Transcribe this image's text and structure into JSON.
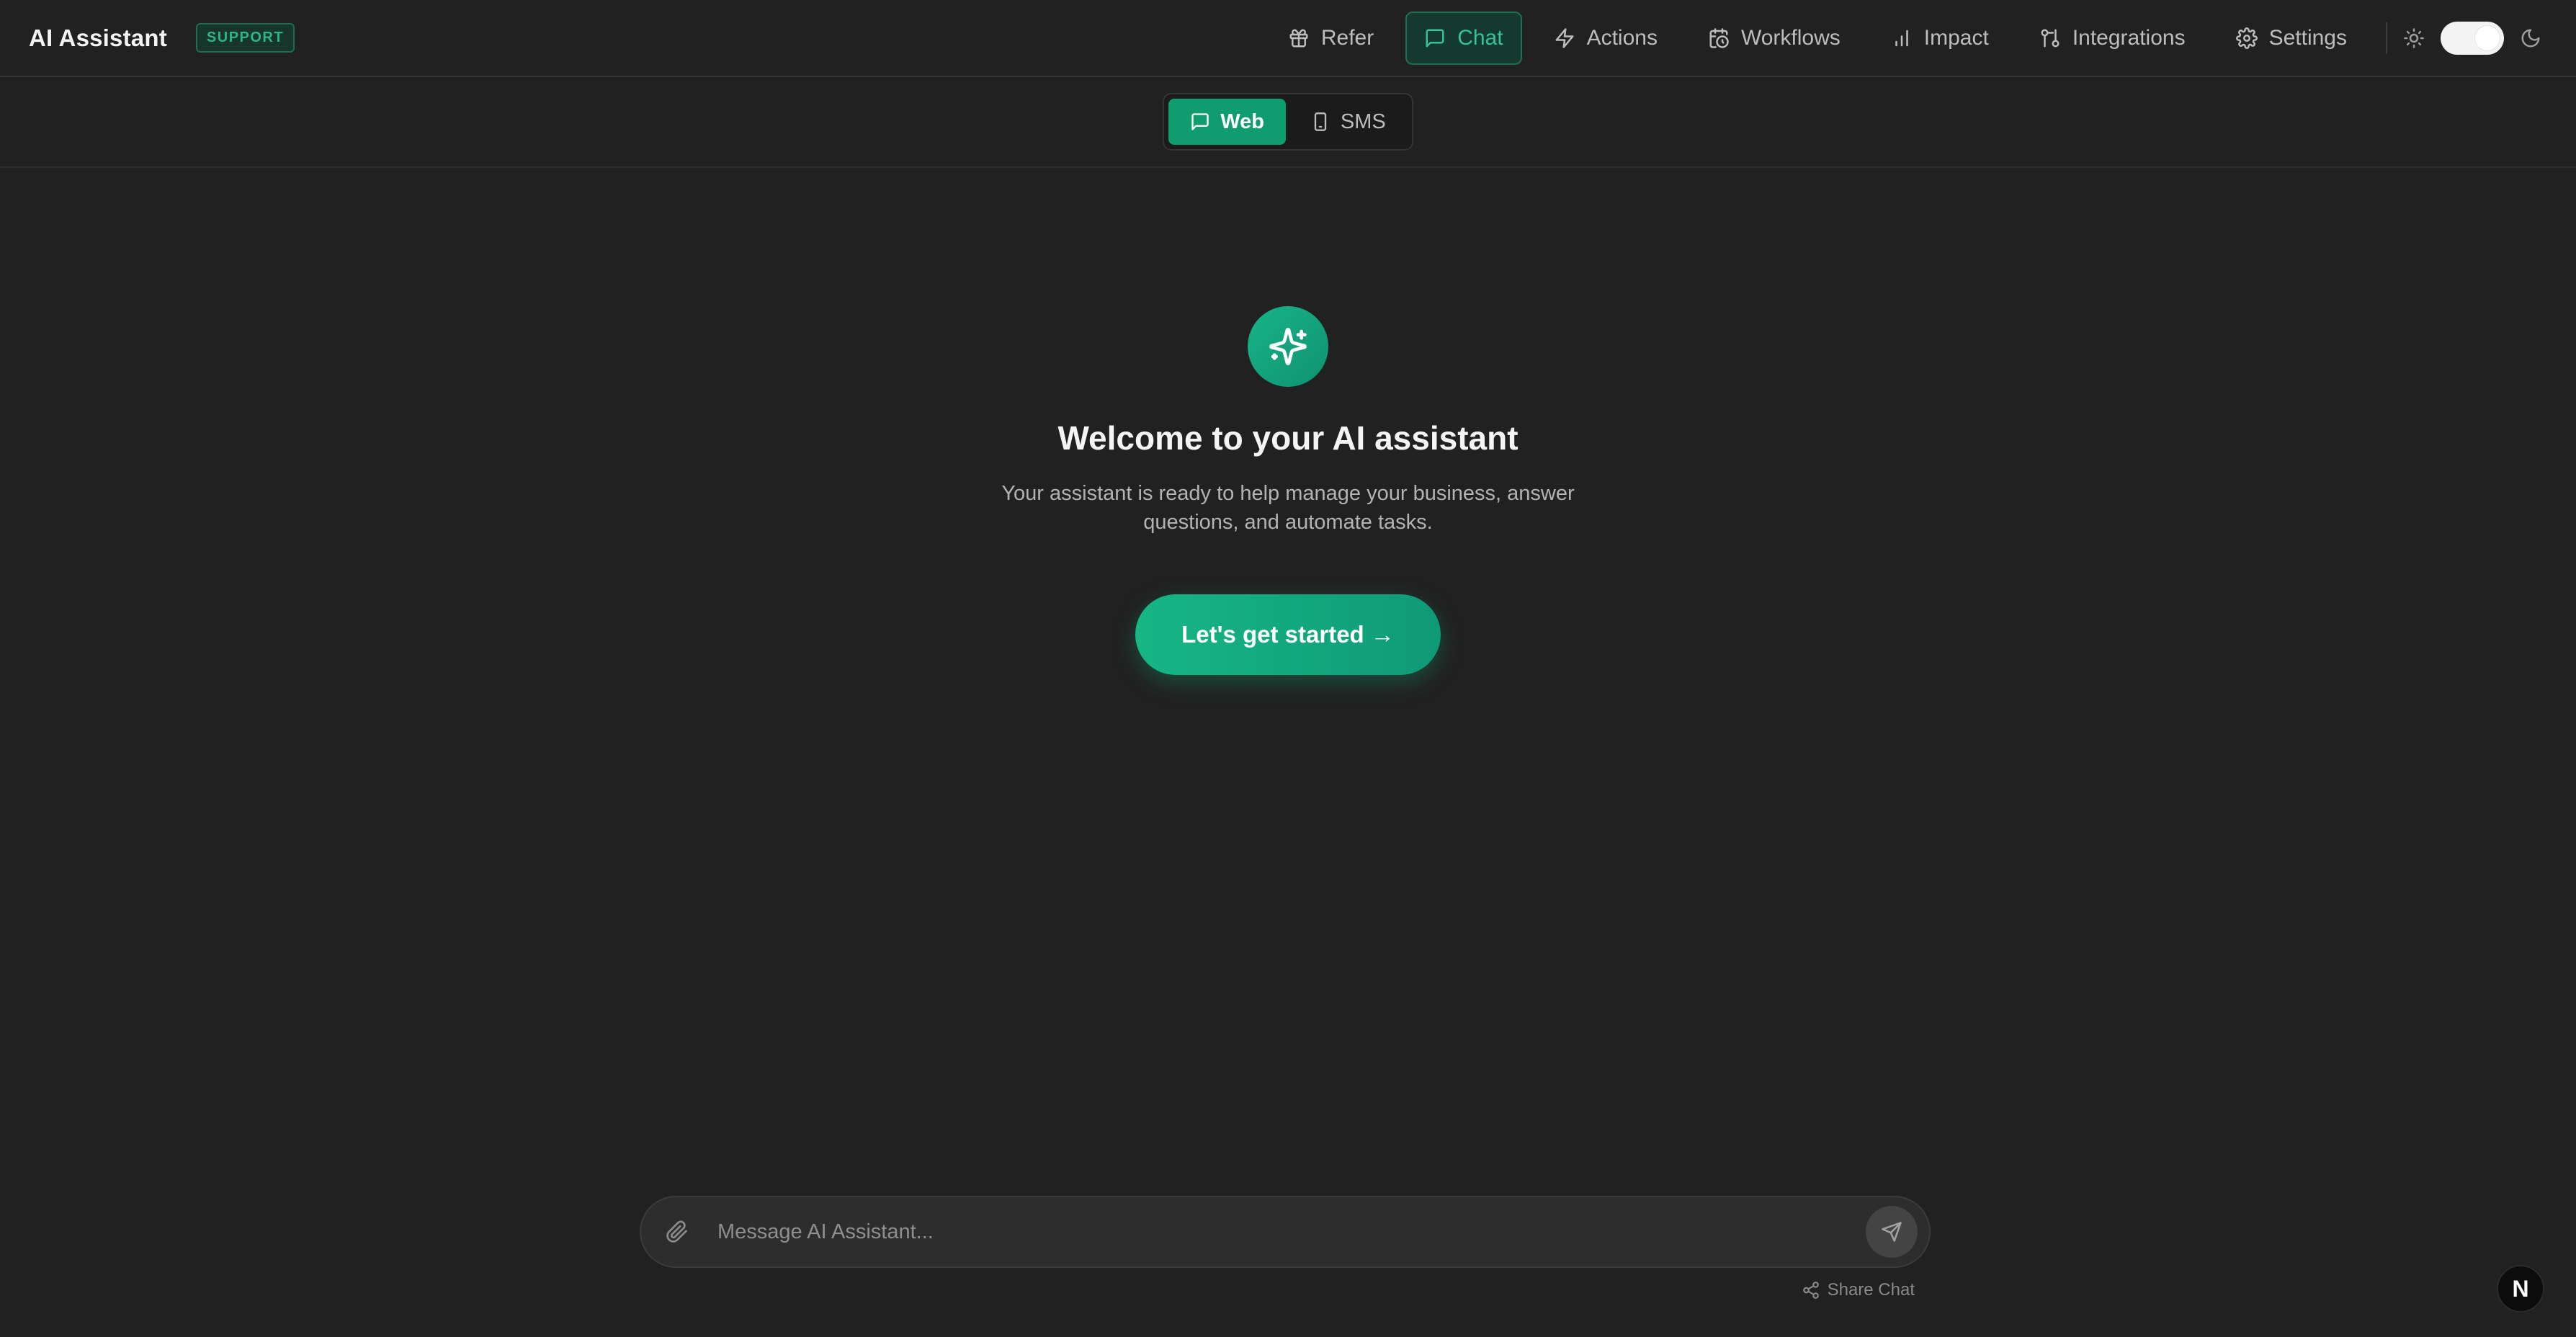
{
  "header": {
    "title": "AI Assistant",
    "badge": "SUPPORT",
    "nav": [
      {
        "label": "Refer",
        "icon": "gift-icon"
      },
      {
        "label": "Chat",
        "icon": "chat-icon",
        "active": true
      },
      {
        "label": "Actions",
        "icon": "lightning-icon"
      },
      {
        "label": "Workflows",
        "icon": "calendar-clock-icon"
      },
      {
        "label": "Impact",
        "icon": "bar-chart-icon"
      },
      {
        "label": "Integrations",
        "icon": "integrations-icon"
      },
      {
        "label": "Settings",
        "icon": "gear-icon"
      }
    ],
    "theme_toggle": {
      "light_icon": "sun-icon",
      "dark_icon": "moon-icon"
    }
  },
  "channel_switch": {
    "options": [
      {
        "label": "Web",
        "icon": "chat-icon",
        "active": true
      },
      {
        "label": "SMS",
        "icon": "phone-icon"
      }
    ]
  },
  "welcome": {
    "icon": "sparkles-icon",
    "title": "Welcome to your AI assistant",
    "subtitle": "Your assistant is ready to help manage your business, answer questions, and automate tasks.",
    "cta_label": "Let's get started →"
  },
  "composer": {
    "placeholder": "Message AI Assistant...",
    "attach_icon": "paperclip-icon",
    "send_icon": "send-icon",
    "share_label": "Share Chat"
  },
  "corner_badge": "N",
  "colors": {
    "background": "#212121",
    "accent": "#0f9c6e",
    "accent_text": "#34c394"
  }
}
